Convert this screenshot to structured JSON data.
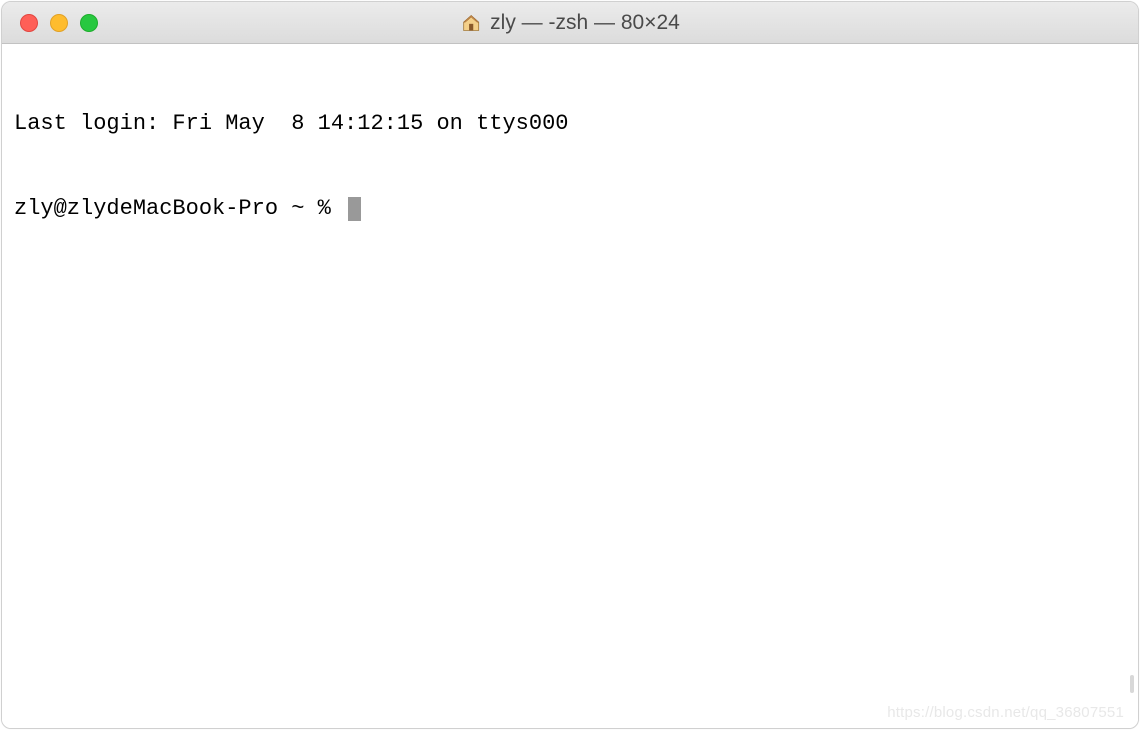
{
  "window": {
    "title": "zly — -zsh — 80×24"
  },
  "terminal": {
    "last_login": "Last login: Fri May  8 14:12:15 on ttys000",
    "prompt": "zly@zlydeMacBook-Pro ~ % "
  },
  "watermark": "https://blog.csdn.net/qq_36807551"
}
